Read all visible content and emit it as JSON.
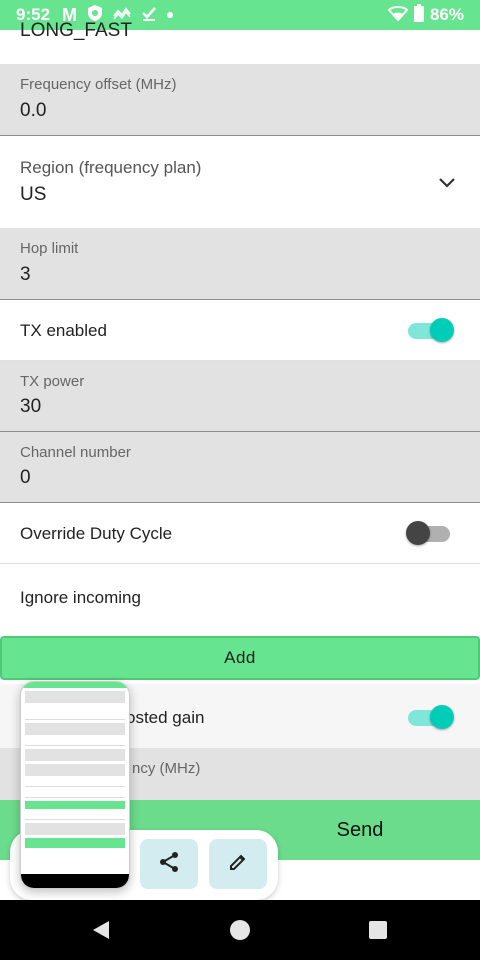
{
  "status_bar": {
    "time": "9:52",
    "battery": "86%",
    "icons": [
      "gmail-icon",
      "shield-icon",
      "network-icon",
      "download-done-icon",
      "dot-icon",
      "wifi-icon",
      "battery-icon"
    ]
  },
  "top_partial_value": "LONG_FAST",
  "frequency_offset": {
    "label": "Frequency offset (MHz)",
    "value": "0.0"
  },
  "region": {
    "label": "Region (frequency plan)",
    "value": "US"
  },
  "hop_limit": {
    "label": "Hop limit",
    "value": "3"
  },
  "tx_enabled": {
    "label": "TX enabled",
    "checked": true
  },
  "tx_power": {
    "label": "TX power",
    "value": "30"
  },
  "channel_number": {
    "label": "Channel number",
    "value": "0"
  },
  "override_duty_cycle": {
    "label": "Override Duty Cycle",
    "checked": false
  },
  "ignore_incoming": {
    "label": "Ignore incoming"
  },
  "add_button": {
    "label": "Add"
  },
  "boosted_gain": {
    "label_partial": "osted gain",
    "checked": true
  },
  "override_frequency": {
    "label_partial": "ncy (MHz)"
  },
  "send_button": {
    "label": "Send"
  },
  "colors": {
    "accent_green": "#67e48f",
    "toggle_on": "#00cdb8",
    "field_bg": "#e2e2e2"
  }
}
